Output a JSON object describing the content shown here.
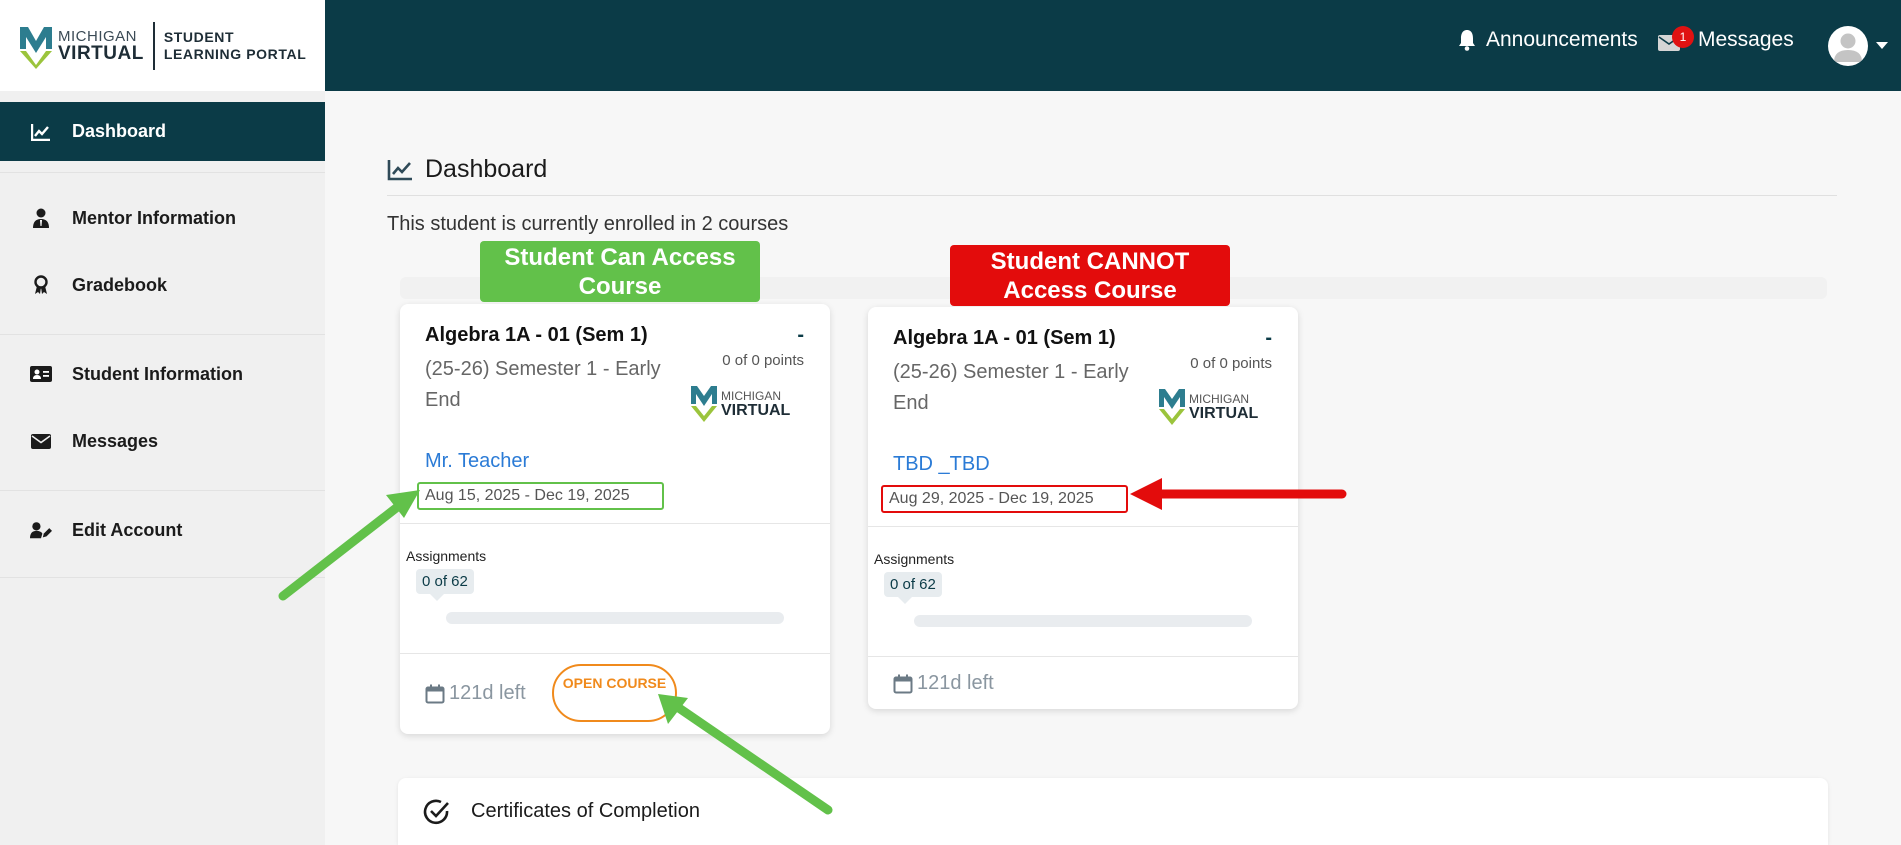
{
  "brand": {
    "logo_line1": "MICHIGAN",
    "logo_line2": "VIRTUAL",
    "portal_line1": "STUDENT",
    "portal_line2": "LEARNING PORTAL"
  },
  "header": {
    "announcements_label": "Announcements",
    "messages_label": "Messages",
    "messages_badge": "1"
  },
  "sidebar": {
    "items": [
      {
        "label": "Dashboard",
        "icon": "chart-icon",
        "active": true
      },
      {
        "label": "Mentor Information",
        "icon": "person-icon"
      },
      {
        "label": "Gradebook",
        "icon": "ribbon-icon"
      },
      {
        "label": "Student Information",
        "icon": "id-card-icon"
      },
      {
        "label": "Messages",
        "icon": "envelope-icon"
      },
      {
        "label": "Edit Account",
        "icon": "user-edit-icon"
      }
    ]
  },
  "main": {
    "title": "Dashboard",
    "enrollment_text": "This student is currently enrolled in 2 courses",
    "callouts": {
      "can_access": "Student Can Access Course",
      "cannot_access": "Student CANNOT Access Course"
    },
    "courses": [
      {
        "title": "Algebra 1A - 01 (Sem 1)",
        "subtitle": "(25-26) Semester 1 - Early End",
        "grade": "-",
        "points": "0 of 0 points",
        "teacher": "Mr. Teacher",
        "dates": "Aug 15, 2025 - Dec 19, 2025",
        "assignments_label": "Assignments",
        "assignments_count": "0 of 62",
        "progress": 0,
        "days_left": "121d left",
        "open_button": "OPEN COURSE"
      },
      {
        "title": "Algebra 1A - 01 (Sem 1)",
        "subtitle": "(25-26) Semester 1 - Early End",
        "grade": "-",
        "points": "0 of 0 points",
        "teacher": "TBD _TBD",
        "dates": "Aug 29, 2025 - Dec 19, 2025",
        "assignments_label": "Assignments",
        "assignments_count": "0 of 62",
        "progress": 0,
        "days_left": "121d left"
      }
    ],
    "certificates_label": "Certificates of Completion"
  },
  "colors": {
    "header_bg": "#0b3b47",
    "accent_orange": "#f08a1c",
    "link_blue": "#2b7bd6",
    "callout_green": "#62c14a",
    "callout_red": "#e30c0c"
  }
}
